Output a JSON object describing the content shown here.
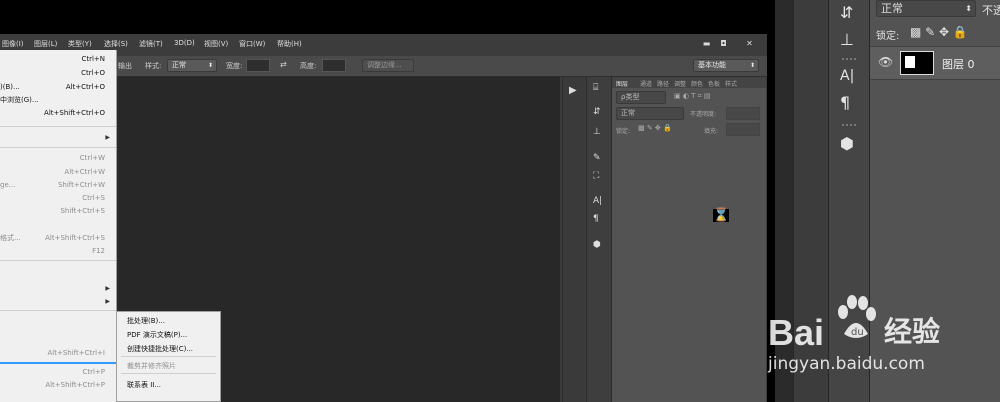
{
  "menubar": {
    "items": [
      "图像(I)",
      "图层(L)",
      "类型(Y)",
      "选择(S)",
      "滤镜(T)",
      "3D(D)",
      "视图(V)",
      "窗口(W)",
      "帮助(H)"
    ],
    "window_buttons": [
      "▬",
      "◘",
      "✕"
    ]
  },
  "options_bar": {
    "btn_fragment": "输出",
    "style_label": "样式:",
    "style_value": "正常",
    "width_label": "宽度:",
    "height_label": "高度:",
    "refine_button": "调整边缘...",
    "workspace": "基本功能"
  },
  "layers_panel": {
    "tabs": [
      "图层",
      "通道",
      "路径",
      "调整",
      "颜色",
      "色板",
      "样式"
    ],
    "filter_label": "ρ类型",
    "blend_mode": "正常",
    "opacity_label": "不透明度:",
    "lock_label": "锁定:",
    "fill_label": "填充:"
  },
  "file_menu": {
    "items": [
      {
        "label": "",
        "shortcut": "Ctrl+N",
        "disabled": false
      },
      {
        "label": "",
        "shortcut": "Ctrl+O",
        "disabled": false
      },
      {
        "label": ")(B)...",
        "shortcut": "Alt+Ctrl+O",
        "disabled": false
      },
      {
        "label": "中浏览(G)...",
        "shortcut": "",
        "disabled": false
      },
      {
        "label": "",
        "shortcut": "Alt+Shift+Ctrl+O",
        "disabled": false
      },
      {
        "label": "",
        "shortcut": "",
        "disabled": false,
        "arrow": true
      },
      {
        "label": "",
        "shortcut": "Ctrl+W",
        "disabled": true
      },
      {
        "label": "",
        "shortcut": "Alt+Ctrl+W",
        "disabled": true
      },
      {
        "label": "ge...",
        "shortcut": "Shift+Ctrl+W",
        "disabled": true
      },
      {
        "label": "",
        "shortcut": "Ctrl+S",
        "disabled": true
      },
      {
        "label": "",
        "shortcut": "Shift+Ctrl+S",
        "disabled": true
      },
      {
        "label": "格式...",
        "shortcut": "Alt+Shift+Ctrl+S",
        "disabled": true
      },
      {
        "label": "",
        "shortcut": "F12",
        "disabled": true
      },
      {
        "label": "",
        "shortcut": "",
        "disabled": false,
        "arrow": true
      },
      {
        "label": "",
        "shortcut": "",
        "disabled": false,
        "arrow": true
      },
      {
        "label": "",
        "shortcut": "Alt+Shift+Ctrl+I",
        "disabled": true
      },
      {
        "label": "",
        "shortcut": "Ctrl+P",
        "disabled": true
      },
      {
        "label": "",
        "shortcut": "Alt+Shift+Ctrl+P",
        "disabled": true
      }
    ]
  },
  "automate_submenu": {
    "items": [
      {
        "label": "批处理(B)...",
        "disabled": false
      },
      {
        "label": "PDF 演示文稿(P)...",
        "disabled": false
      },
      {
        "label": "创建快捷批处理(C)...",
        "disabled": false
      },
      {
        "label": "裁剪并修齐照片",
        "disabled": true
      },
      {
        "label": "联系表 II...",
        "disabled": false
      }
    ]
  },
  "right_panel": {
    "blend_mode": "正常",
    "opacity_fragment": "不透",
    "lock_label": "锁定:",
    "layer_name": "图层 0"
  },
  "watermark": {
    "brand_latin": "Bai",
    "brand_suffix": "du",
    "brand_cn": "经验",
    "url": "jingyan.baidu.com"
  },
  "colors": {
    "highlight": "#3399ff",
    "canvas": "#282828",
    "panel": "#535353"
  }
}
